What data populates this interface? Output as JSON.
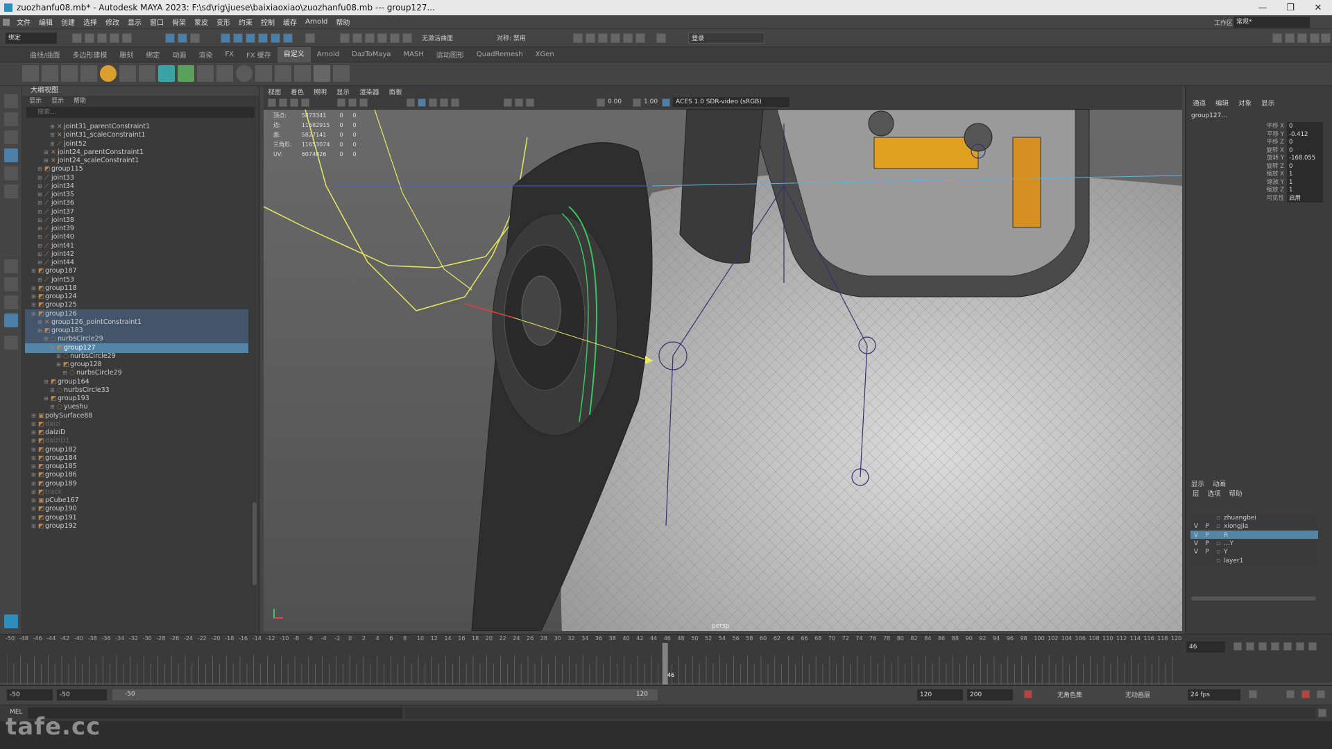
{
  "titlebar": {
    "title": "zuozhanfu08.mb* - Autodesk MAYA 2023: F:\\sd\\rig\\juese\\baixiaoxiao\\zuozhanfu08.mb  ---  group127..."
  },
  "menubar": {
    "items": [
      "文件",
      "编辑",
      "创建",
      "选择",
      "修改",
      "显示",
      "窗口",
      "骨架",
      "蒙皮",
      "变形",
      "约束",
      "控制",
      "缓存",
      "Arnold",
      "帮助"
    ],
    "workspace_label": "工作区:",
    "workspace_value": "常规*"
  },
  "statusline": {
    "mode": "绑定",
    "no_live_surface": "无激活曲面",
    "symmetry": "对称: 禁用",
    "login": "登录"
  },
  "shelf": {
    "tabs": [
      "曲线/曲面",
      "多边形建模",
      "雕刻",
      "绑定",
      "动画",
      "渲染",
      "FX",
      "FX 缓存",
      "自定义",
      "Arnold",
      "DazToMaya",
      "MASH",
      "运动图形",
      "QuadRemesh",
      "XGen"
    ],
    "active_tab": "自定义"
  },
  "outliner": {
    "title": "大纲视图",
    "menu": [
      "显示",
      "显示",
      "帮助"
    ],
    "search_placeholder": "搜索...",
    "rows": [
      {
        "label": "joint31_parentConstraint1",
        "indent": 4,
        "icon": "constraint",
        "state": ""
      },
      {
        "label": "joint31_scaleConstraint1",
        "indent": 4,
        "icon": "constraint",
        "state": ""
      },
      {
        "label": "joint52",
        "indent": 4,
        "icon": "joint",
        "state": ""
      },
      {
        "label": "joint24_parentConstraint1",
        "indent": 3,
        "icon": "constraint",
        "state": ""
      },
      {
        "label": "joint24_scaleConstraint1",
        "indent": 3,
        "icon": "constraint",
        "state": ""
      },
      {
        "label": "group115",
        "indent": 2,
        "icon": "group",
        "state": ""
      },
      {
        "label": "joint33",
        "indent": 2,
        "icon": "joint",
        "state": ""
      },
      {
        "label": "joint34",
        "indent": 2,
        "icon": "joint",
        "state": ""
      },
      {
        "label": "joint35",
        "indent": 2,
        "icon": "joint",
        "state": ""
      },
      {
        "label": "joint36",
        "indent": 2,
        "icon": "joint",
        "state": ""
      },
      {
        "label": "joint37",
        "indent": 2,
        "icon": "joint",
        "state": ""
      },
      {
        "label": "joint38",
        "indent": 2,
        "icon": "joint",
        "state": ""
      },
      {
        "label": "joint39",
        "indent": 2,
        "icon": "joint",
        "state": ""
      },
      {
        "label": "joint40",
        "indent": 2,
        "icon": "joint",
        "state": ""
      },
      {
        "label": "joint41",
        "indent": 2,
        "icon": "joint",
        "state": ""
      },
      {
        "label": "joint42",
        "indent": 2,
        "icon": "joint",
        "state": ""
      },
      {
        "label": "joint44",
        "indent": 2,
        "icon": "joint",
        "state": ""
      },
      {
        "label": "group187",
        "indent": 1,
        "icon": "group",
        "state": ""
      },
      {
        "label": "joint53",
        "indent": 2,
        "icon": "joint",
        "state": ""
      },
      {
        "label": "group118",
        "indent": 1,
        "icon": "group",
        "state": ""
      },
      {
        "label": "group124",
        "indent": 1,
        "icon": "group",
        "state": ""
      },
      {
        "label": "group125",
        "indent": 1,
        "icon": "group",
        "state": ""
      },
      {
        "label": "group126",
        "indent": 1,
        "icon": "group",
        "state": "hl"
      },
      {
        "label": "group126_pointConstraint1",
        "indent": 2,
        "icon": "constraint",
        "state": "hl"
      },
      {
        "label": "group183",
        "indent": 2,
        "icon": "group",
        "state": "hl"
      },
      {
        "label": "nurbsCircle29",
        "indent": 3,
        "icon": "curve",
        "state": "hl"
      },
      {
        "label": "group127",
        "indent": 4,
        "icon": "group",
        "state": "sel"
      },
      {
        "label": "nurbsCircle29",
        "indent": 5,
        "icon": "curve",
        "state": ""
      },
      {
        "label": "group128",
        "indent": 5,
        "icon": "group",
        "state": ""
      },
      {
        "label": "nurbsCircle29",
        "indent": 6,
        "icon": "curve",
        "state": ""
      },
      {
        "label": "group164",
        "indent": 3,
        "icon": "group",
        "state": ""
      },
      {
        "label": "nurbsCircle33",
        "indent": 4,
        "icon": "curve",
        "state": ""
      },
      {
        "label": "group193",
        "indent": 3,
        "icon": "group",
        "state": ""
      },
      {
        "label": "yueshu",
        "indent": 4,
        "icon": "curve",
        "state": ""
      },
      {
        "label": "polySurface88",
        "indent": 1,
        "icon": "mesh",
        "state": ""
      },
      {
        "label": "daizi",
        "indent": 1,
        "icon": "group",
        "state": "dim"
      },
      {
        "label": "daiziD",
        "indent": 1,
        "icon": "group",
        "state": ""
      },
      {
        "label": "daiziD1",
        "indent": 1,
        "icon": "group",
        "state": "dim"
      },
      {
        "label": "group182",
        "indent": 1,
        "icon": "group",
        "state": ""
      },
      {
        "label": "group184",
        "indent": 1,
        "icon": "group",
        "state": ""
      },
      {
        "label": "group185",
        "indent": 1,
        "icon": "group",
        "state": ""
      },
      {
        "label": "group186",
        "indent": 1,
        "icon": "group",
        "state": ""
      },
      {
        "label": "group189",
        "indent": 1,
        "icon": "group",
        "state": ""
      },
      {
        "label": "track",
        "indent": 1,
        "icon": "group",
        "state": "dim"
      },
      {
        "label": "pCube167",
        "indent": 1,
        "icon": "mesh",
        "state": ""
      },
      {
        "label": "group190",
        "indent": 1,
        "icon": "group",
        "state": ""
      },
      {
        "label": "group191",
        "indent": 1,
        "icon": "group",
        "state": ""
      },
      {
        "label": "group192",
        "indent": 1,
        "icon": "group",
        "state": ""
      }
    ]
  },
  "viewport": {
    "menu": [
      "视图",
      "着色",
      "照明",
      "显示",
      "渲染器",
      "面板"
    ],
    "exposure": "0.00",
    "gamma": "1.00",
    "colorspace": "ACES 1.0 SDR-video (sRGB)",
    "camera_label": "persp",
    "hud": [
      {
        "label": "顶点:",
        "a": "5873341",
        "b": "0",
        "c": "0"
      },
      {
        "label": "边:",
        "a": "11682915",
        "b": "0",
        "c": "0"
      },
      {
        "label": "面:",
        "a": "5827141",
        "b": "0",
        "c": "0"
      },
      {
        "label": "三角形:",
        "a": "11653074",
        "b": "0",
        "c": "0"
      },
      {
        "label": "UV:",
        "a": "6074026",
        "b": "0",
        "c": "0"
      }
    ]
  },
  "channelbox": {
    "tabs": [
      "通道",
      "编辑",
      "对象",
      "显示"
    ],
    "object": "group127...",
    "channels": [
      {
        "label": "平移 X",
        "value": "0"
      },
      {
        "label": "平移 Y",
        "value": "-0.412"
      },
      {
        "label": "平移 Z",
        "value": "0"
      },
      {
        "label": "旋转 X",
        "value": "0"
      },
      {
        "label": "旋转 Y",
        "value": "-168.055"
      },
      {
        "label": "旋转 Z",
        "value": "0"
      },
      {
        "label": "缩放 X",
        "value": "1"
      },
      {
        "label": "缩放 Y",
        "value": "1"
      },
      {
        "label": "缩放 Z",
        "value": "1"
      },
      {
        "label": "可见性",
        "value": "启用"
      }
    ],
    "layer_tabs": [
      "显示",
      "动画"
    ],
    "layer_menu": [
      "层",
      "选项",
      "帮助"
    ],
    "layers": [
      {
        "v": "",
        "p": "",
        "name": "zhuangbei",
        "sel": false
      },
      {
        "v": "V",
        "p": "P",
        "name": "xiongjia",
        "sel": false
      },
      {
        "v": "V",
        "p": "P",
        "name": "R",
        "sel": true
      },
      {
        "v": "V",
        "p": "P",
        "name": "...Y",
        "sel": false
      },
      {
        "v": "V",
        "p": "P",
        "name": "Y",
        "sel": false
      },
      {
        "v": "",
        "p": "",
        "name": "layer1",
        "sel": false
      }
    ]
  },
  "timeslider": {
    "ticks": [
      "-50",
      "-48",
      "-46",
      "-44",
      "-42",
      "-40",
      "-38",
      "-36",
      "-34",
      "-32",
      "-30",
      "-28",
      "-26",
      "-24",
      "-22",
      "-20",
      "-18",
      "-16",
      "-14",
      "-12",
      "-10",
      "-8",
      "-6",
      "-4",
      "-2",
      "0",
      "2",
      "4",
      "6",
      "8",
      "10",
      "12",
      "14",
      "16",
      "18",
      "20",
      "22",
      "24",
      "26",
      "28",
      "30",
      "32",
      "34",
      "36",
      "38",
      "40",
      "42",
      "44",
      "46",
      "48",
      "50",
      "52",
      "54",
      "56",
      "58",
      "60",
      "62",
      "64",
      "66",
      "68",
      "70",
      "72",
      "74",
      "76",
      "78",
      "80",
      "82",
      "84",
      "86",
      "88",
      "90",
      "92",
      "94",
      "96",
      "98",
      "100",
      "102",
      "104",
      "106",
      "108",
      "110",
      "112",
      "114",
      "116",
      "118",
      "120"
    ],
    "current_frame_label": "46",
    "current_frame_field": "46",
    "current_frame": 46
  },
  "rangebar": {
    "start": "-50",
    "start_inner": "-50",
    "range_start": "-50",
    "range_end": "120",
    "end_inner": "120",
    "end": "200",
    "no_char_set": "无角色集",
    "no_anim_layer": "无动画层",
    "fps": "24 fps"
  },
  "cmdline": {
    "label": "MEL"
  },
  "watermark": {
    "text": "tafe.cc"
  }
}
